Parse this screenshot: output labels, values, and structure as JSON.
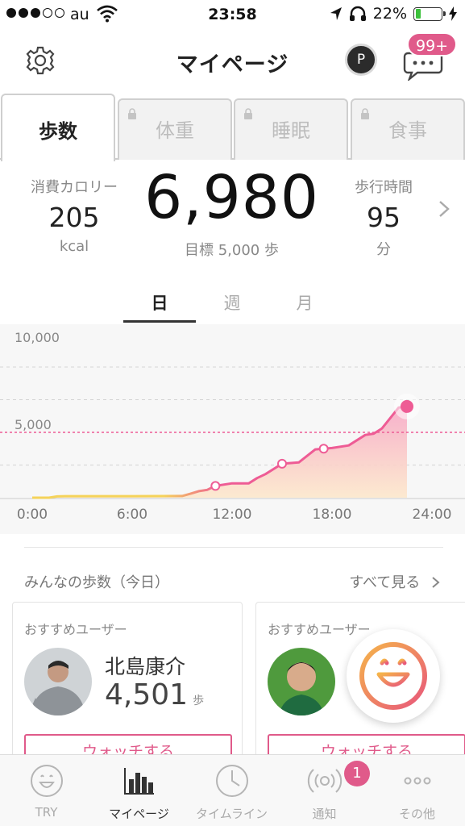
{
  "status_bar": {
    "carrier": "au",
    "time": "23:58",
    "battery_percent": "22%"
  },
  "header": {
    "title": "マイページ",
    "points_label": "P",
    "notification_badge": "99+"
  },
  "tabs": [
    {
      "label": "歩数",
      "active": true,
      "locked": false
    },
    {
      "label": "体重",
      "active": false,
      "locked": true
    },
    {
      "label": "睡眠",
      "active": false,
      "locked": true
    },
    {
      "label": "食事",
      "active": false,
      "locked": true
    }
  ],
  "stats": {
    "calories": {
      "label": "消費カロリー",
      "value": "205",
      "unit": "kcal"
    },
    "steps": "6,980",
    "goal_text": "目標 5,000 歩",
    "walk_time": {
      "label": "歩行時間",
      "value": "95",
      "unit": "分"
    }
  },
  "period_tabs": [
    {
      "label": "日",
      "active": true
    },
    {
      "label": "週",
      "active": false
    },
    {
      "label": "月",
      "active": false
    }
  ],
  "chart_data": {
    "type": "area",
    "y_ticks": [
      "10,000",
      "5,000"
    ],
    "x_ticks": [
      "0:00",
      "6:00",
      "12:00",
      "18:00",
      "24:00"
    ],
    "ylim": [
      0,
      10000
    ],
    "xlim": [
      0,
      24
    ],
    "goal_line": 5000,
    "series": [
      {
        "x": [
          0,
          1,
          1.5,
          2,
          6,
          9,
          9.5,
          10,
          10.5,
          11,
          12,
          13,
          13.5,
          14,
          15,
          16,
          16.5,
          17,
          18,
          19,
          20,
          20.5,
          21,
          22,
          22.5
        ],
        "y": [
          0,
          0,
          100,
          120,
          120,
          130,
          300,
          500,
          600,
          900,
          1100,
          1100,
          1500,
          1800,
          2600,
          2700,
          3200,
          3700,
          3800,
          4000,
          4800,
          4900,
          5300,
          6900,
          6980
        ]
      }
    ],
    "markers_x": [
      11,
      15,
      17.5,
      22.5
    ],
    "colors": {
      "line": "#ee5c95",
      "fill_top": "#f7a8c6",
      "fill_bottom": "#fde7c9",
      "line_start": "#f5d35a"
    }
  },
  "community": {
    "title": "みんなの歩数（今日）",
    "see_all": "すべて見る",
    "cards": [
      {
        "label": "おすすめユーザー",
        "name": "北島康介",
        "steps": "4,501",
        "unit": "歩",
        "button": "ウォッチする"
      },
      {
        "label": "おすすめユーザー",
        "name": "",
        "steps": "",
        "unit": "",
        "button": "ウォッチする"
      }
    ]
  },
  "bottom_nav": [
    {
      "label": "TRY",
      "icon": "smile-icon",
      "active": false
    },
    {
      "label": "マイページ",
      "icon": "bar-chart-icon",
      "active": true
    },
    {
      "label": "タイムライン",
      "icon": "clock-icon",
      "active": false
    },
    {
      "label": "通知",
      "icon": "broadcast-icon",
      "active": false,
      "badge": "1"
    },
    {
      "label": "その他",
      "icon": "more-icon",
      "active": false
    }
  ]
}
